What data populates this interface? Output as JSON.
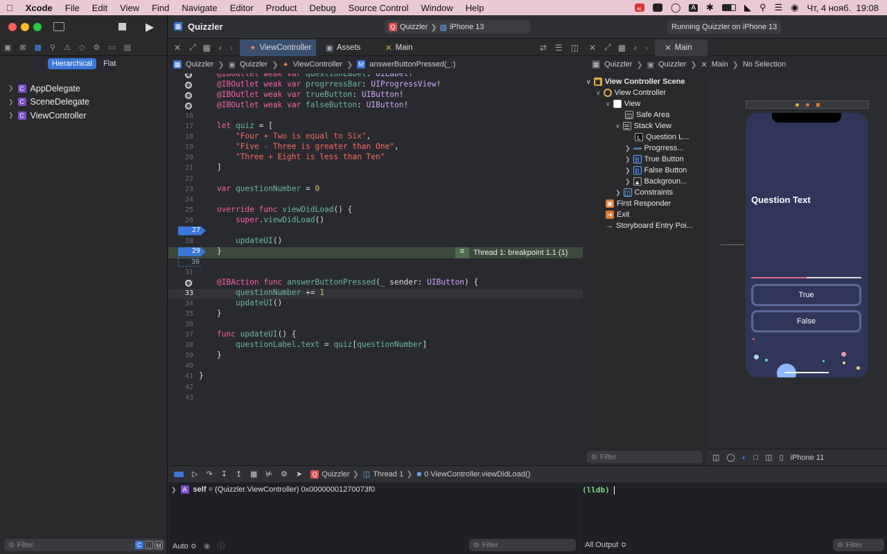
{
  "menubar": {
    "app": "Xcode",
    "items": [
      "File",
      "Edit",
      "View",
      "Find",
      "Navigate",
      "Editor",
      "Product",
      "Debug",
      "Source Control",
      "Window",
      "Help"
    ],
    "badge": "46",
    "clock": "Чт, 4 нояб.  19:08",
    "input_lang": "A"
  },
  "toolbar": {
    "project": "Quizzler",
    "scheme": "Quizzler",
    "device": "iPhone 13",
    "status": "Running Quizzler on iPhone 13"
  },
  "navigator": {
    "seg_hier": "Hierarchical",
    "seg_flat": "Flat",
    "files": [
      "AppDelegate",
      "SceneDelegate",
      "ViewController"
    ],
    "filter_placeholder": "Filter"
  },
  "tabs": {
    "left": [
      "ViewController",
      "Assets",
      "Main"
    ],
    "right": "Main"
  },
  "jumpbar": {
    "left": [
      "Quizzler",
      "Quizzler",
      "ViewController",
      "answerButtonPressed(_:)"
    ],
    "right": [
      "Quizzler",
      "Quizzler",
      "Main",
      "No Selection"
    ]
  },
  "code": {
    "thread_label": "Thread 1: breakpoint 1.1 (1)",
    "lines": [
      {
        "n": "",
        "t": "@IBOutlet weak var questionLabel: UILabel!"
      },
      {
        "n": "",
        "t": "@IBOutlet weak var progrressBar: UIProgressView!"
      },
      {
        "n": "",
        "t": "@IBOutlet weak var trueButton: UIButton!"
      },
      {
        "n": "",
        "t": "@IBOutlet weak var falseButton: UIButton!"
      },
      {
        "n": "16",
        "t": ""
      },
      {
        "n": "17",
        "t": "let quiz = ["
      },
      {
        "n": "18",
        "t": "    \"Four + Two is equal to Six\","
      },
      {
        "n": "19",
        "t": "    \"Five - Three is greater than One\","
      },
      {
        "n": "20",
        "t": "    \"Three + Eight is less than Ten\""
      },
      {
        "n": "21",
        "t": "]"
      },
      {
        "n": "22",
        "t": ""
      },
      {
        "n": "23",
        "t": "var questionNumber = 0"
      },
      {
        "n": "24",
        "t": ""
      },
      {
        "n": "25",
        "t": "override func viewDidLoad() {"
      },
      {
        "n": "26",
        "t": "    super.viewDidLoad()"
      },
      {
        "n": "27",
        "t": ""
      },
      {
        "n": "28",
        "t": "    updateUI()"
      },
      {
        "n": "29",
        "t": "}"
      },
      {
        "n": "30",
        "t": ""
      },
      {
        "n": "31",
        "t": ""
      },
      {
        "n": "32",
        "t": "@IBAction func answerButtonPressed(_ sender: UIButton) {"
      },
      {
        "n": "33",
        "t": "    questionNumber += 1"
      },
      {
        "n": "34",
        "t": "    updateUI()"
      },
      {
        "n": "35",
        "t": "}"
      },
      {
        "n": "36",
        "t": ""
      },
      {
        "n": "37",
        "t": "func updateUI() {"
      },
      {
        "n": "38",
        "t": "    questionLabel.text = quiz[questionNumber]"
      },
      {
        "n": "39",
        "t": "}"
      },
      {
        "n": "40",
        "t": ""
      },
      {
        "n": "41",
        "t": "}"
      },
      {
        "n": "42",
        "t": ""
      },
      {
        "n": "43",
        "t": ""
      }
    ]
  },
  "outline": {
    "items": [
      "View Controller Scene",
      "View Controller",
      "View",
      "Safe Area",
      "Stack View",
      "Question L...",
      "Progrress...",
      "True Button",
      "False Button",
      "Backgroun...",
      "Constraints",
      "First Responder",
      "Exit",
      "Storyboard Entry Poi..."
    ],
    "filter_placeholder": "Filter"
  },
  "canvas": {
    "question": "Question Text",
    "true_btn": "True",
    "false_btn": "False",
    "device": "iPhone 11",
    "progress": 0.5
  },
  "debug": {
    "path": [
      "Quizzler",
      "Thread 1",
      "0 ViewController.viewDidLoad()"
    ],
    "var_name": "self",
    "var_value": " = (Quizzler.ViewController) 0x00000001270073f0",
    "auto": "Auto ≎",
    "filter_placeholder": "Filter",
    "console_prompt": "(lldb)",
    "output_select": "All Output ≎"
  },
  "colors": {
    "accent": "#3a77d8",
    "highlight": "#3c4a3d",
    "canvas_bg": "#2f3659",
    "menubar": "#e8c9d4"
  }
}
